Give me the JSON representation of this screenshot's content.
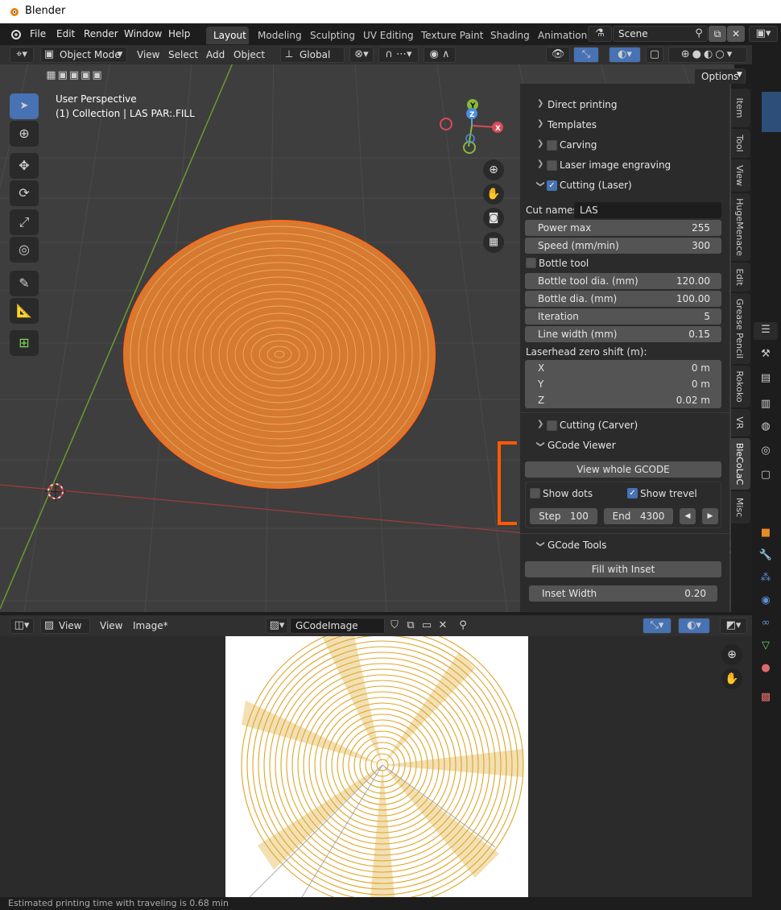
{
  "window": {
    "title": "Blender"
  },
  "menu": {
    "items": [
      "File",
      "Edit",
      "Render",
      "Window",
      "Help"
    ]
  },
  "workspaces": {
    "tabs": [
      "Layout",
      "Modeling",
      "Sculpting",
      "UV Editing",
      "Texture Paint",
      "Shading",
      "Animation"
    ],
    "active": "Layout"
  },
  "scene": {
    "name": "Scene"
  },
  "viewport": {
    "mode": "Object Mode",
    "menus": [
      "View",
      "Select",
      "Add",
      "Object"
    ],
    "transform_orientation": "Global",
    "options_label": "Options",
    "perspective_label": "User Perspective",
    "collection_label": "(1) Collection | LAS PAR:.FILL"
  },
  "gizmo": {
    "x": "X",
    "y": "Y",
    "z": "Z"
  },
  "panel": {
    "sections": [
      {
        "label": "Direct printing",
        "has_checkbox": false
      },
      {
        "label": "Templates",
        "has_checkbox": false
      },
      {
        "label": "Carving",
        "has_checkbox": true,
        "checked": false
      },
      {
        "label": "Laser image engraving",
        "has_checkbox": true,
        "checked": false
      },
      {
        "label": "Cutting (Laser)",
        "has_checkbox": true,
        "checked": true
      }
    ],
    "cut_names_label": "Cut names:",
    "cut_names_value": "LAS",
    "power_max": {
      "label": "Power max",
      "value": "255"
    },
    "speed": {
      "label": "Speed (mm/min)",
      "value": "300"
    },
    "bottle_tool": {
      "label": "Bottle tool",
      "checked": false
    },
    "bottle_tool_dia": {
      "label": "Bottle tool dia. (mm)",
      "value": "120.00"
    },
    "bottle_dia": {
      "label": "Bottle dia. (mm)",
      "value": "100.00"
    },
    "iteration": {
      "label": "Iteration",
      "value": "5"
    },
    "line_width": {
      "label": "Line width (mm)",
      "value": "0.15"
    },
    "laserhead_label": "Laserhead zero shift (m):",
    "shift_x": {
      "label": "X",
      "value": "0 m"
    },
    "shift_y": {
      "label": "Y",
      "value": "0 m"
    },
    "shift_z": {
      "label": "Z",
      "value": "0.02 m"
    },
    "cutting_carver": {
      "label": "Cutting (Carver)",
      "checked": false
    },
    "gcode_viewer": {
      "label": "GCode Viewer"
    },
    "view_whole": "View whole GCODE",
    "show_dots": {
      "label": "Show dots",
      "checked": false
    },
    "show_travel": {
      "label": "Show trevel",
      "checked": true
    },
    "step": {
      "label": "Step",
      "value": "100"
    },
    "end": {
      "label": "End",
      "value": "4300"
    },
    "gcode_tools": {
      "label": "GCode Tools"
    },
    "fill_inset": "Fill with Inset",
    "inset_width": {
      "label": "Inset Width",
      "value": "0.20"
    }
  },
  "sidebar_tabs": [
    "Item",
    "Tool",
    "View",
    "HugeMenace",
    "Edit",
    "Grease Pencil",
    "Rokoko",
    "VR",
    "BleCoLaC",
    "Misc"
  ],
  "sidebar_active": "BleCoLaC",
  "image_editor": {
    "menus": [
      "View",
      "Image*"
    ],
    "view_label": "View",
    "image_name": "GCodeImage"
  },
  "status": {
    "text": "Estimated printing time with traveling is 0.68 min"
  },
  "colors": {
    "accent": "#4772b3",
    "orange": "#e8782a",
    "gold": "#e0b22a",
    "bracket": "#ff5a00"
  }
}
